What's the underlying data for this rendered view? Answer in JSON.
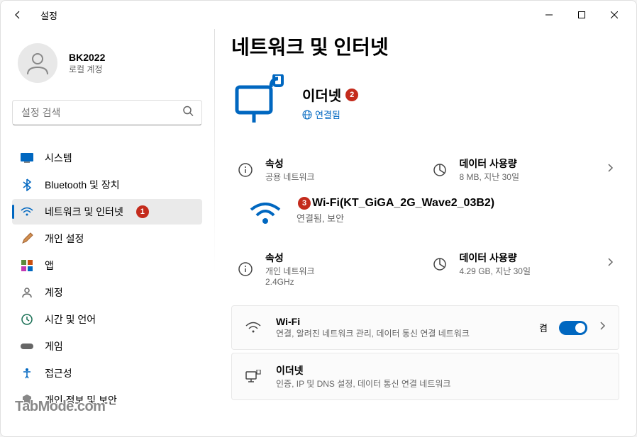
{
  "window": {
    "title": "설정"
  },
  "user": {
    "name": "BK2022",
    "type": "로컬 계정"
  },
  "search": {
    "placeholder": "설정 검색"
  },
  "nav": {
    "items": [
      {
        "label": "시스템"
      },
      {
        "label": "Bluetooth 및 장치"
      },
      {
        "label": "네트워크 및 인터넷",
        "badge": "1"
      },
      {
        "label": "개인 설정"
      },
      {
        "label": "앱"
      },
      {
        "label": "계정"
      },
      {
        "label": "시간 및 언어"
      },
      {
        "label": "게임"
      },
      {
        "label": "접근성"
      },
      {
        "label": "개인 정보 및 보안"
      }
    ]
  },
  "page": {
    "title": "네트워크 및 인터넷"
  },
  "ethernet": {
    "title": "이더넷",
    "badge": "2",
    "status": "연결됨",
    "props_label": "속성",
    "props_sub": "공용 네트워크",
    "usage_label": "데이터 사용량",
    "usage_sub": "8 MB, 지난 30일"
  },
  "wifi_current": {
    "badge": "3",
    "title": "Wi-Fi(KT_GiGA_2G_Wave2_03B2)",
    "sub": "연결됨, 보안",
    "props_label": "속성",
    "props_sub1": "개인 네트워크",
    "props_sub2": "2.4GHz",
    "usage_label": "데이터 사용량",
    "usage_sub": "4.29 GB, 지난 30일"
  },
  "wifi_card": {
    "title": "Wi-Fi",
    "sub": "연결, 알려진 네트워크 관리, 데이터 통신 연결 네트워크",
    "toggle_label": "켬"
  },
  "eth_card": {
    "title": "이더넷",
    "sub": "인증, IP 및 DNS 설정, 데이터 통신 연결 네트워크"
  },
  "watermark": "TabMode.com"
}
